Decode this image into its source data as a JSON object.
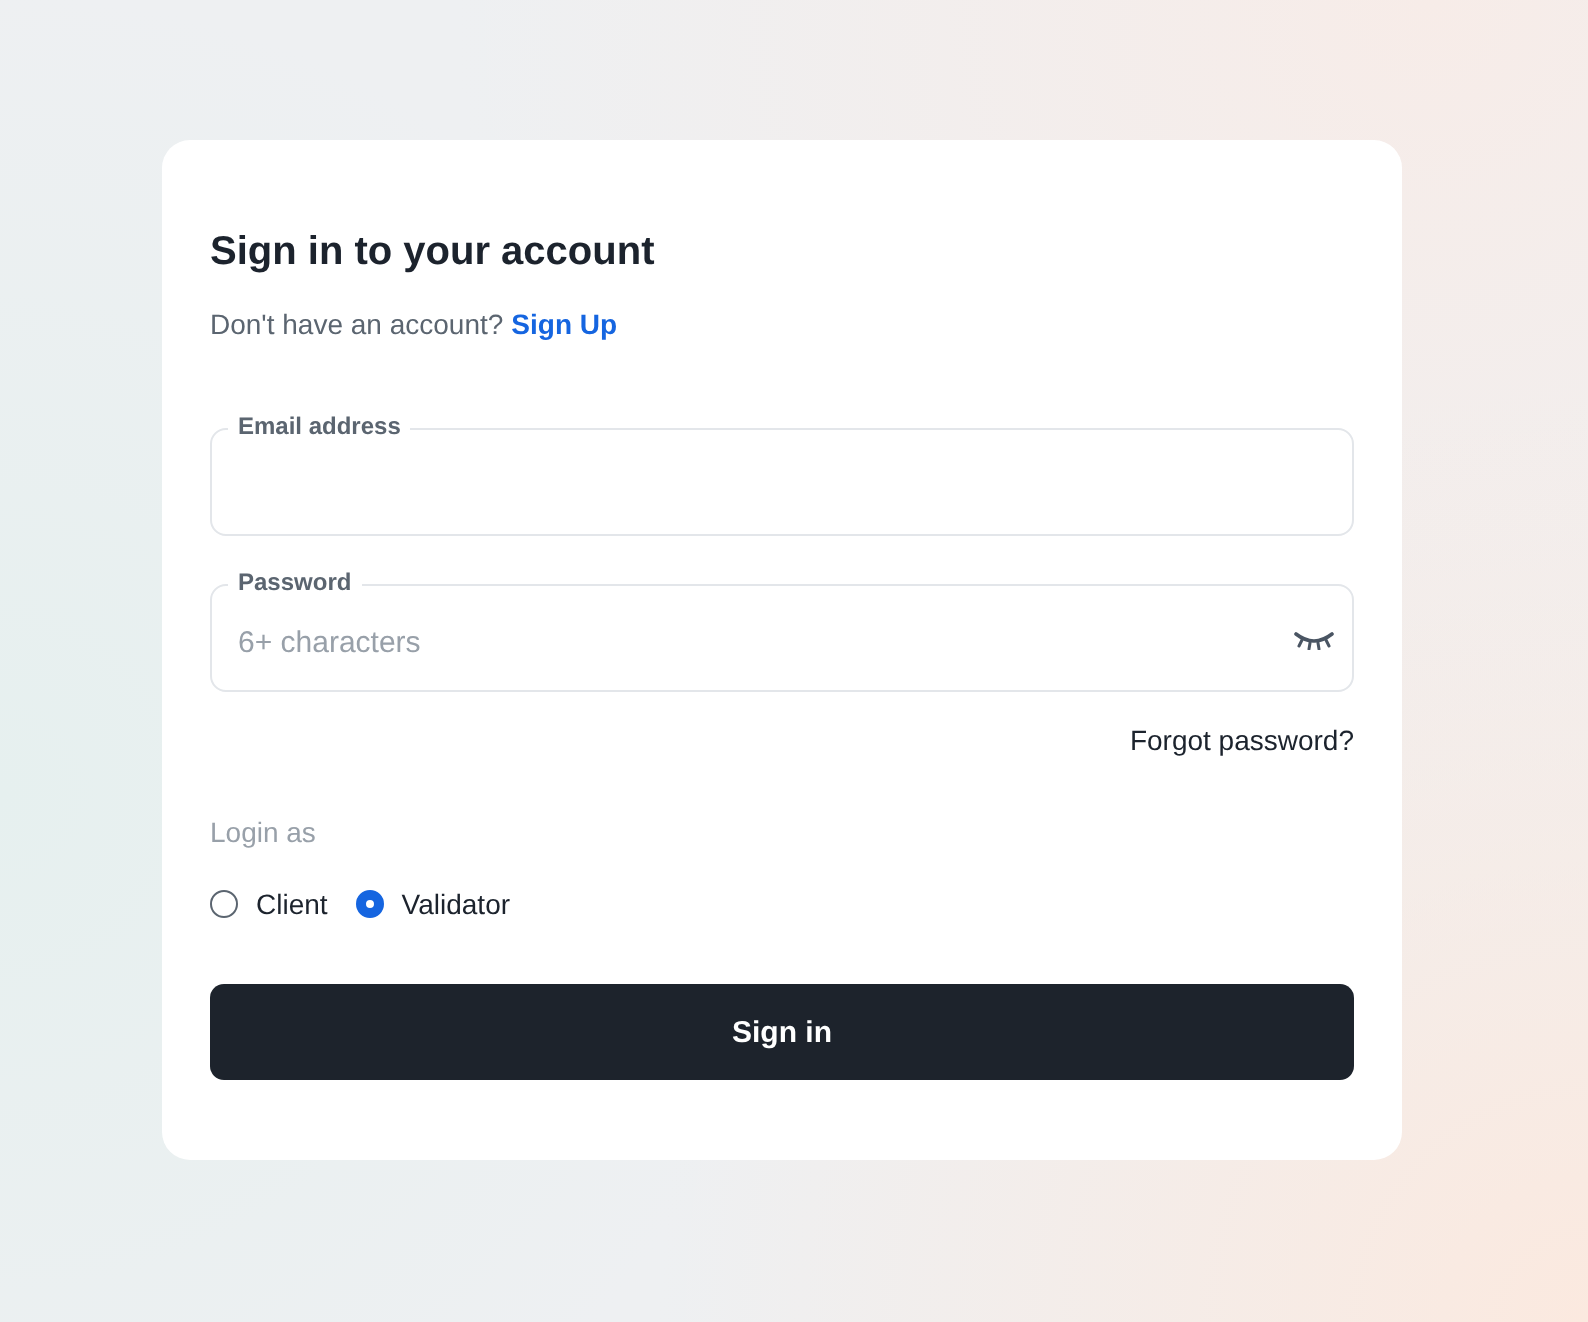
{
  "title": "Sign in to your account",
  "signup": {
    "prompt": "Don't have an account?",
    "link": "Sign Up"
  },
  "fields": [
    {
      "kind": "email",
      "label": "Email address"
    },
    {
      "kind": "password",
      "label": "Password",
      "placeholder": "6+ characters"
    }
  ],
  "forgot_link": "Forgot password?",
  "login_as": {
    "label": "Login as",
    "options": [
      {
        "label": "Client",
        "selected": false
      },
      {
        "label": "Validator",
        "selected": true
      }
    ]
  },
  "submit": "Sign in"
}
